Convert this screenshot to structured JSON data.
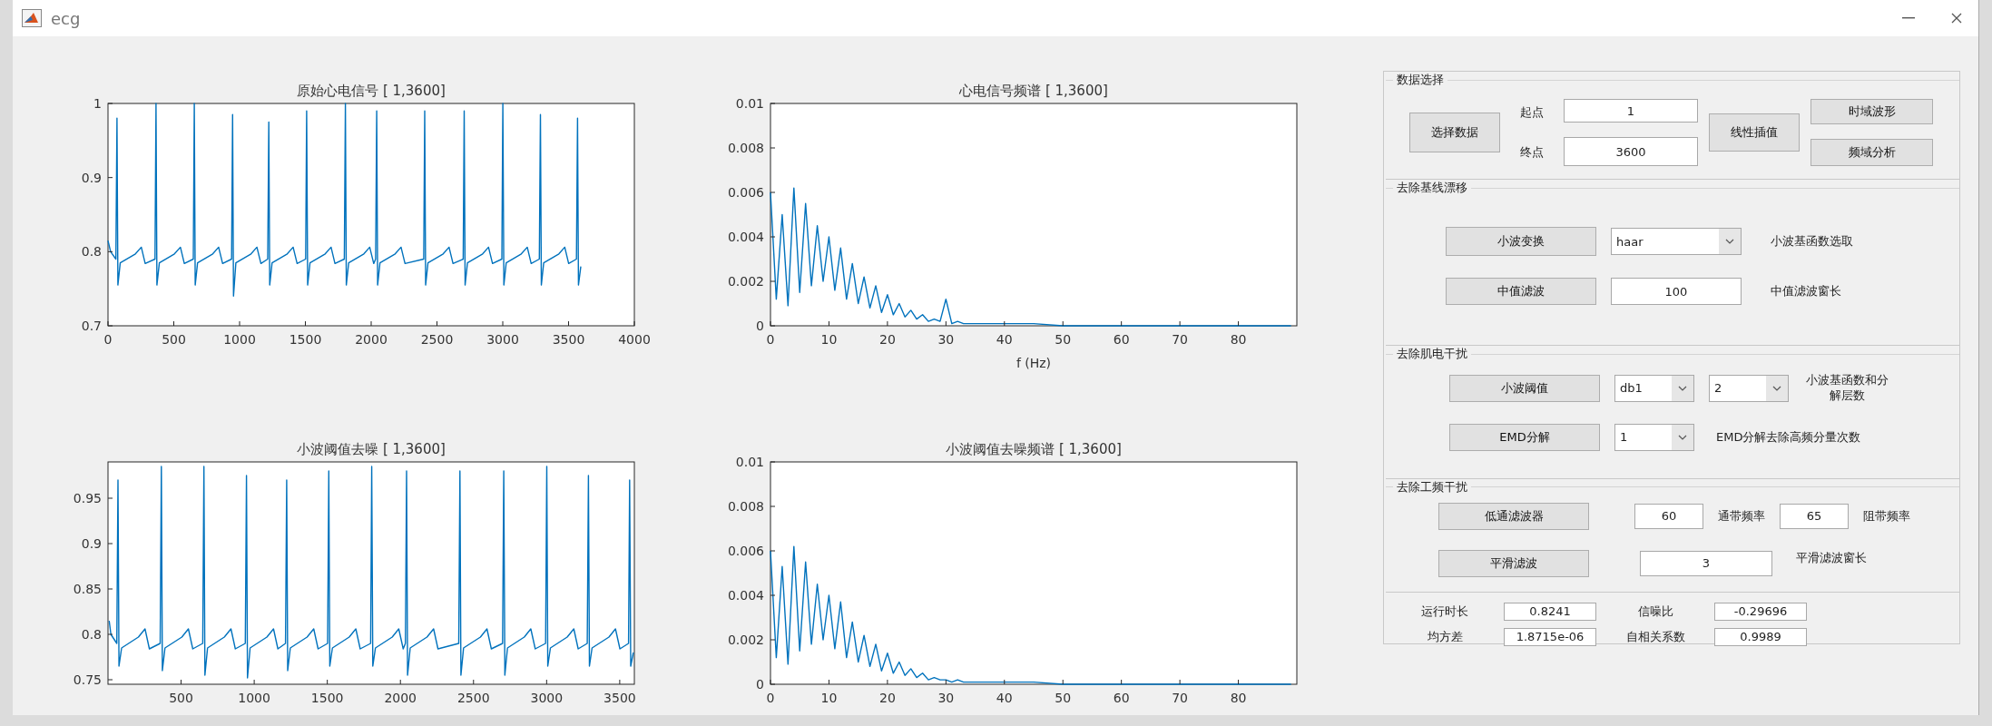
{
  "window": {
    "title": "ecg"
  },
  "plots": [
    {
      "chart_data": {
        "type": "line",
        "title": "原始心电信号 [ 1,3600]",
        "xlim": [
          0,
          4000
        ],
        "ylim": [
          0.7,
          1
        ],
        "xticks": [
          0,
          500,
          1000,
          1500,
          2000,
          2500,
          3000,
          3500,
          4000
        ],
        "yticks": [
          0.7,
          0.8,
          0.9,
          1
        ],
        "x": [
          0,
          20,
          60,
          68,
          75,
          93,
          208,
          253,
          283,
          357,
          365,
          372,
          390,
          505,
          550,
          580,
          648,
          656,
          663,
          681,
          796,
          841,
          871,
          939,
          947,
          954,
          972,
          1087,
          1132,
          1162,
          1214,
          1222,
          1229,
          1247,
          1362,
          1407,
          1437,
          1502,
          1510,
          1517,
          1535,
          1650,
          1695,
          1725,
          1796,
          1804,
          1811,
          1829,
          1944,
          1989,
          2019,
          2034,
          2042,
          2049,
          2067,
          2182,
          2227,
          2257,
          2399,
          2407,
          2414,
          2432,
          2547,
          2592,
          2622,
          2699,
          2707,
          2714,
          2732,
          2847,
          2892,
          2922,
          2993,
          3001,
          3008,
          3026,
          3141,
          3186,
          3216,
          3278,
          3286,
          3293,
          3311,
          3426,
          3471,
          3501,
          3560,
          3568,
          3575,
          3593
        ],
        "series": [
          {
            "color": "#0072bd",
            "values": [
              0.815,
              0.8,
              0.79,
              0.98,
              0.755,
              0.785,
              0.797,
              0.806,
              0.784,
              0.79,
              1.0,
              0.755,
              0.785,
              0.797,
              0.806,
              0.784,
              0.79,
              1.0,
              0.755,
              0.785,
              0.797,
              0.806,
              0.784,
              0.79,
              0.985,
              0.74,
              0.785,
              0.797,
              0.806,
              0.784,
              0.79,
              0.975,
              0.755,
              0.785,
              0.797,
              0.806,
              0.784,
              0.79,
              0.99,
              0.755,
              0.785,
              0.797,
              0.806,
              0.784,
              0.79,
              1.0,
              0.755,
              0.785,
              0.797,
              0.806,
              0.784,
              0.79,
              0.99,
              0.755,
              0.785,
              0.797,
              0.806,
              0.784,
              0.79,
              0.99,
              0.755,
              0.785,
              0.797,
              0.806,
              0.784,
              0.79,
              0.99,
              0.755,
              0.785,
              0.797,
              0.806,
              0.784,
              0.79,
              1.0,
              0.755,
              0.785,
              0.797,
              0.806,
              0.784,
              0.79,
              0.985,
              0.755,
              0.785,
              0.797,
              0.806,
              0.784,
              0.79,
              0.98,
              0.755,
              0.78
            ]
          }
        ]
      }
    },
    {
      "chart_data": {
        "type": "line",
        "title": "心电信号频谱 [ 1,3600]",
        "xlabel": "f (Hz)",
        "xlim": [
          0,
          90
        ],
        "ylim": [
          0,
          0.01
        ],
        "xticks": [
          0,
          10,
          20,
          30,
          40,
          50,
          60,
          70,
          80
        ],
        "yticks": [
          0,
          0.002,
          0.004,
          0.006,
          0.008,
          0.01
        ],
        "x": [
          0,
          1,
          2,
          3,
          4,
          5,
          6,
          7,
          8,
          9,
          10,
          11,
          12,
          13,
          14,
          15,
          16,
          17,
          18,
          19,
          20,
          21,
          22,
          23,
          24,
          25,
          26,
          27,
          28,
          29,
          30,
          31,
          32,
          33,
          34,
          35,
          36,
          37,
          38,
          39,
          40,
          45,
          50,
          55,
          60,
          65,
          70,
          75,
          80,
          85,
          89
        ],
        "series": [
          {
            "color": "#0072bd",
            "values": [
              0.006,
              0.0012,
              0.005,
              0.0009,
              0.0062,
              0.0015,
              0.0055,
              0.0018,
              0.0045,
              0.002,
              0.004,
              0.0016,
              0.0035,
              0.0012,
              0.0028,
              0.001,
              0.0022,
              0.0008,
              0.0018,
              0.0006,
              0.0014,
              0.0005,
              0.001,
              0.0004,
              0.0007,
              0.0003,
              0.0005,
              0.0002,
              0.0003,
              0.0002,
              0.0012,
              0.0001,
              0.0002,
              0.0001,
              0.0001,
              0.0001,
              0.0001,
              0.0001,
              0.0001,
              0.0001,
              0.0001,
              0.0001,
              0,
              0,
              0,
              0,
              0,
              0,
              0,
              0,
              0
            ]
          }
        ]
      }
    },
    {
      "chart_data": {
        "type": "line",
        "title": "小波阈值去噪 [ 1,3600]",
        "xlim": [
          0,
          3600
        ],
        "ylim": [
          0.745,
          0.99
        ],
        "xticks": [
          500,
          1000,
          1500,
          2000,
          2500,
          3000,
          3500
        ],
        "yticks": [
          0.75,
          0.8,
          0.85,
          0.9,
          0.95
        ],
        "x": [
          8,
          20,
          60,
          68,
          75,
          93,
          208,
          253,
          283,
          357,
          365,
          372,
          390,
          505,
          550,
          580,
          648,
          656,
          663,
          681,
          796,
          841,
          871,
          939,
          947,
          954,
          972,
          1087,
          1132,
          1162,
          1214,
          1222,
          1229,
          1247,
          1362,
          1407,
          1437,
          1502,
          1510,
          1517,
          1535,
          1650,
          1695,
          1725,
          1796,
          1804,
          1811,
          1829,
          1944,
          1989,
          2019,
          2034,
          2042,
          2049,
          2067,
          2182,
          2227,
          2257,
          2399,
          2407,
          2414,
          2432,
          2547,
          2592,
          2622,
          2699,
          2707,
          2714,
          2732,
          2847,
          2892,
          2922,
          2993,
          3001,
          3008,
          3026,
          3141,
          3186,
          3216,
          3278,
          3286,
          3293,
          3311,
          3426,
          3471,
          3501,
          3560,
          3568,
          3575,
          3593
        ],
        "series": [
          {
            "color": "#0072bd",
            "values": [
              0.815,
              0.8,
              0.79,
              0.97,
              0.765,
              0.785,
              0.797,
              0.806,
              0.784,
              0.79,
              0.985,
              0.76,
              0.785,
              0.797,
              0.806,
              0.784,
              0.79,
              0.985,
              0.755,
              0.785,
              0.797,
              0.806,
              0.784,
              0.79,
              0.975,
              0.752,
              0.785,
              0.797,
              0.806,
              0.784,
              0.79,
              0.97,
              0.76,
              0.785,
              0.797,
              0.806,
              0.784,
              0.79,
              0.98,
              0.765,
              0.785,
              0.797,
              0.806,
              0.784,
              0.79,
              0.985,
              0.765,
              0.785,
              0.797,
              0.806,
              0.784,
              0.79,
              0.98,
              0.755,
              0.785,
              0.797,
              0.806,
              0.784,
              0.79,
              0.98,
              0.755,
              0.785,
              0.797,
              0.806,
              0.784,
              0.79,
              0.98,
              0.755,
              0.785,
              0.797,
              0.806,
              0.784,
              0.79,
              0.985,
              0.765,
              0.785,
              0.797,
              0.806,
              0.784,
              0.79,
              0.975,
              0.765,
              0.785,
              0.797,
              0.806,
              0.784,
              0.79,
              0.97,
              0.765,
              0.78
            ]
          }
        ]
      }
    },
    {
      "chart_data": {
        "type": "line",
        "title": "小波阈值去噪频谱 [ 1,3600]",
        "xlim": [
          0,
          90
        ],
        "ylim": [
          0,
          0.01
        ],
        "xticks": [
          0,
          10,
          20,
          30,
          40,
          50,
          60,
          70,
          80
        ],
        "yticks": [
          0,
          0.002,
          0.004,
          0.006,
          0.008,
          0.01
        ],
        "x": [
          0,
          1,
          2,
          3,
          4,
          5,
          6,
          7,
          8,
          9,
          10,
          11,
          12,
          13,
          14,
          15,
          16,
          17,
          18,
          19,
          20,
          21,
          22,
          23,
          24,
          25,
          26,
          27,
          28,
          29,
          30,
          31,
          32,
          33,
          34,
          35,
          36,
          37,
          38,
          39,
          40,
          45,
          50,
          55,
          60,
          65,
          70,
          75,
          80,
          85,
          89
        ],
        "series": [
          {
            "color": "#0072bd",
            "values": [
              0.006,
              0.0012,
              0.0053,
              0.0009,
              0.0062,
              0.0015,
              0.0055,
              0.0018,
              0.0045,
              0.002,
              0.004,
              0.0016,
              0.0037,
              0.0012,
              0.0028,
              0.001,
              0.0022,
              0.0008,
              0.0018,
              0.0006,
              0.0014,
              0.0005,
              0.001,
              0.0004,
              0.0007,
              0.0003,
              0.0005,
              0.0002,
              0.0003,
              0.0002,
              0.0002,
              0.0001,
              0.0002,
              0.0001,
              0.0001,
              0.0001,
              0.0001,
              0.0001,
              0.0001,
              0.0001,
              0.0001,
              0.0001,
              0,
              0,
              0,
              0,
              0,
              0,
              0,
              0,
              0
            ]
          }
        ]
      }
    }
  ],
  "data_select": {
    "title": "数据选择",
    "select_button": "选择数据",
    "start_label": "起点",
    "start_value": "1",
    "end_label": "终点",
    "end_value": "3600",
    "interp_button": "线性插值",
    "time_button": "时域波形",
    "freq_button": "频域分析"
  },
  "baseline": {
    "title": "去除基线漂移",
    "wavelet_button": "小波变换",
    "wavelet_select": "haar",
    "wavelet_hint": "小波基函数选取",
    "median_button": "中值滤波",
    "median_value": "100",
    "median_hint": "中值滤波窗长"
  },
  "emg": {
    "title": "去除肌电干扰",
    "threshold_button": "小波阈值",
    "basis_select": "db1",
    "level_select": "2",
    "threshold_hint": "小波基函数和分解层数",
    "emd_button": "EMD分解",
    "emd_select": "1",
    "emd_hint": "EMD分解去除高频分量次数"
  },
  "powerline": {
    "title": "去除工频干扰",
    "lowpass_button": "低通滤波器",
    "passband_value": "60",
    "passband_label": "通带频率",
    "stopband_value": "65",
    "stopband_label": "阻带频率",
    "smooth_button": "平滑滤波",
    "smooth_value": "3",
    "smooth_hint": "平滑滤波窗长"
  },
  "metrics": [
    {
      "label": "运行时长",
      "value": "0.8241"
    },
    {
      "label": "信噪比",
      "value": "-0.29696"
    },
    {
      "label": "均方差",
      "value": "1.8715e-06"
    },
    {
      "label": "自相关系数",
      "value": "0.9989"
    }
  ]
}
